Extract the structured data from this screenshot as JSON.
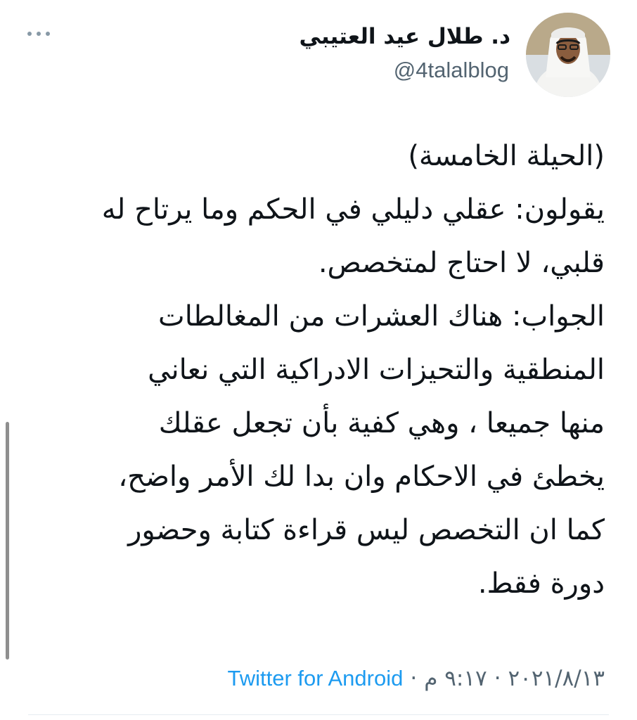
{
  "author": {
    "display_name": "د. طلال عيد العتيبي",
    "handle": "@4talalblog",
    "avatar_icon": "user-avatar-photo"
  },
  "more_icon": "more-horizontal-icon",
  "tweet": {
    "paragraphs": [
      {
        "lines": [
          "(الحيلة الخامسة)",
          "يقولون: عقلي دليلي في الحكم وما يرتاح له",
          "قلبي، لا احتاج لمتخصص."
        ]
      },
      {
        "lines": [
          "الجواب: هناك العشرات من المغالطات",
          "المنطقية والتحيزات الادراكية التي نعاني",
          "منها جميعا ، وهي كفية بأن تجعل عقلك",
          "يخطئ في الاحكام وان بدا لك الأمر واضح،",
          "كما ان التخصص ليس قراءة كتابة وحضور",
          "دورة فقط."
        ]
      }
    ]
  },
  "meta": {
    "date": "٢٠٢١/٨/١٣",
    "time": "٩:١٧ م",
    "separator": "·",
    "source": "Twitter for Android"
  },
  "colors": {
    "text": "#0f1419",
    "secondary": "#536471",
    "link": "#1d9bf0"
  }
}
